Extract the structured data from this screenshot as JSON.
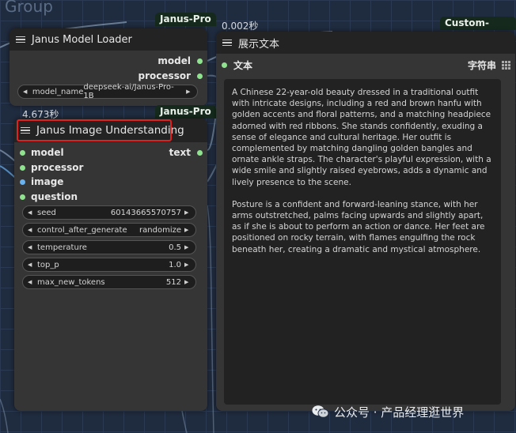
{
  "group": {
    "title": "Group"
  },
  "badges": {
    "janus_pro_1": "Janus-Pro",
    "janus_pro_2": "Janus-Pro",
    "custom_scripts": "Custom-Scripts"
  },
  "timings": {
    "loader_time": "4.673秒",
    "display_time": "0.002秒"
  },
  "loader": {
    "title": "Janus Model Loader",
    "outputs": [
      "model",
      "processor"
    ],
    "widget": {
      "name": "model_name",
      "value": "deepseek-ai/Janus-Pro-1B"
    }
  },
  "understanding": {
    "title": "Janus Image Understanding",
    "inputs": [
      "model",
      "processor",
      "image",
      "question"
    ],
    "output": "text",
    "widgets": [
      {
        "name": "seed",
        "value": "60143665570757"
      },
      {
        "name": "control_after_generate",
        "value": "randomize"
      },
      {
        "name": "temperature",
        "value": "0.5"
      },
      {
        "name": "top_p",
        "value": "1.0"
      },
      {
        "name": "max_new_tokens",
        "value": "512"
      }
    ]
  },
  "display": {
    "title": "展示文本",
    "input_label": "文本",
    "output_label": "字符串",
    "paragraphs": [
      "A Chinese 22-year-old beauty dressed in a traditional outfit with intricate designs, including a red and brown hanfu with golden accents and floral patterns, and a matching headpiece adorned with red ribbons. She stands confidently, exuding a sense of elegance and cultural heritage. Her outfit is complemented by matching dangling golden bangles and ornate ankle straps. The character's playful expression, with a wide smile and slightly raised eyebrows, adds a dynamic and lively presence to the scene.",
      "Posture is a confident and forward-leaning stance, with her arms outstretched, palms facing upwards and slightly apart, as if she is about to perform an action or dance. Her feet are positioned on rocky terrain, with flames engulfing the rock beneath her, creating a dramatic and mystical atmosphere."
    ]
  },
  "watermark": {
    "text": "公众号 · 产品经理逛世界"
  },
  "colors": {
    "highlight": "#e02121",
    "dot_green": "#8fe38f",
    "dot_blue": "#6ab1f0"
  }
}
